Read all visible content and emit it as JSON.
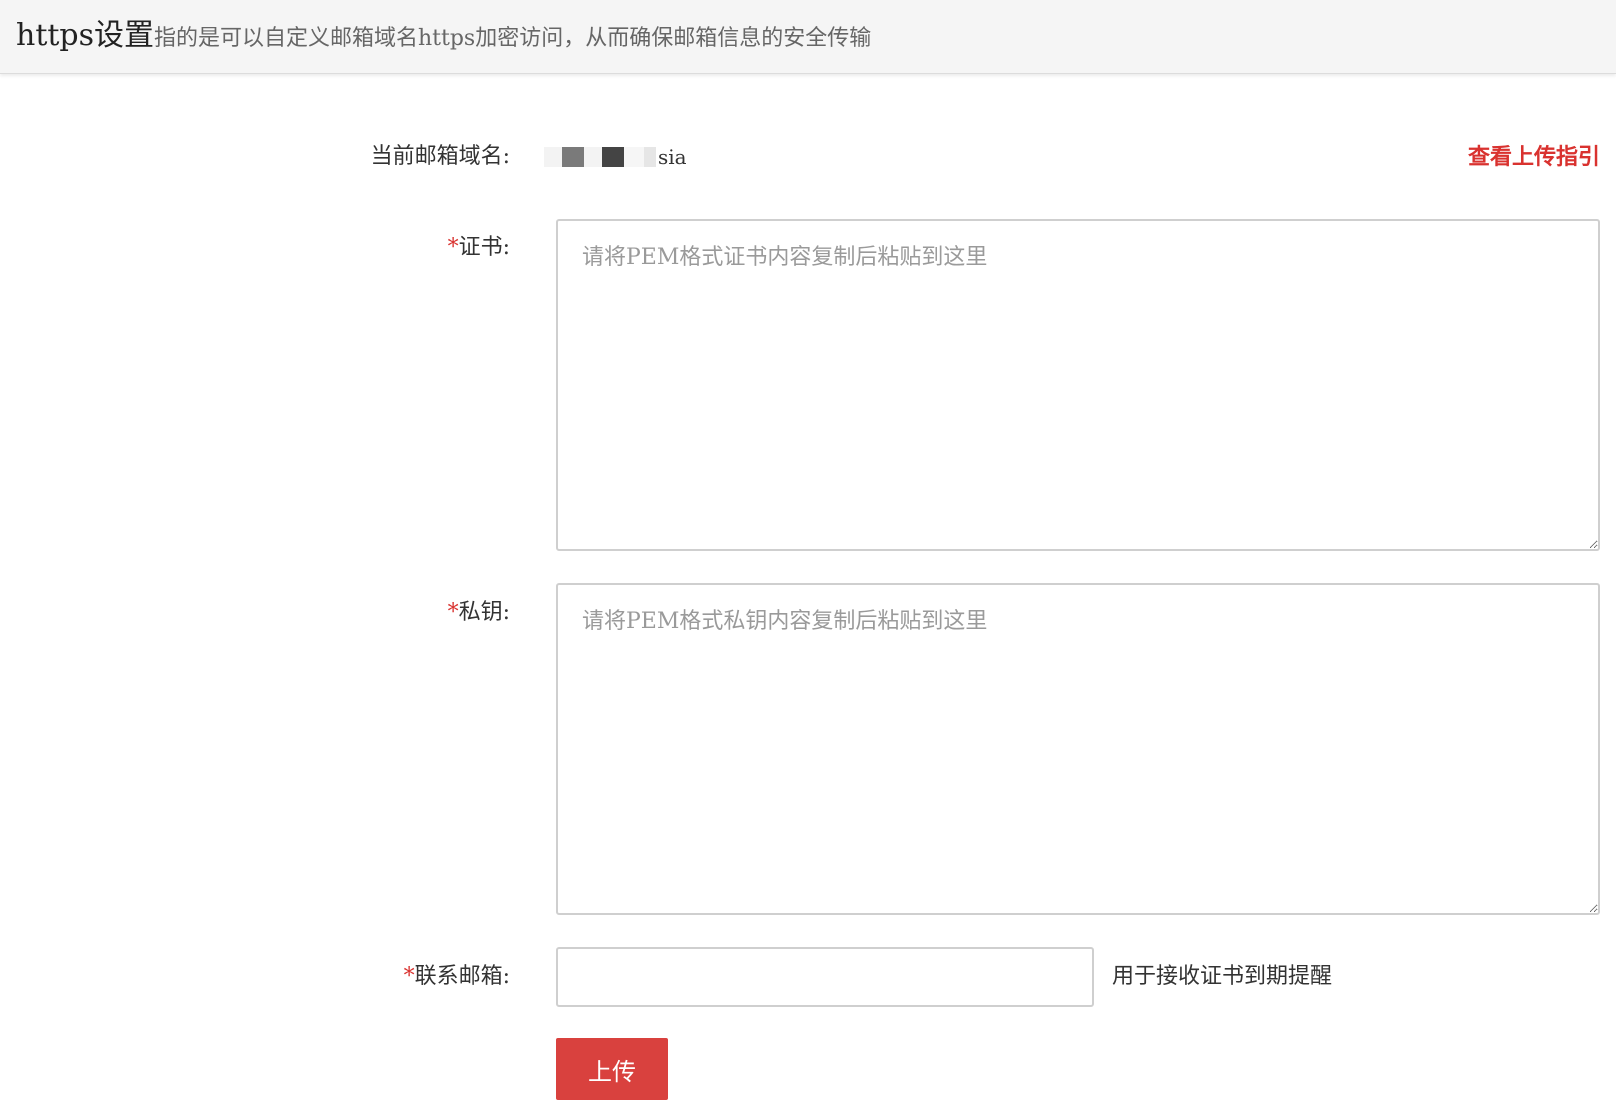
{
  "header": {
    "title": "https设置",
    "description": "指的是可以自定义邮箱域名https加密访问，从而确保邮箱信息的安全传输"
  },
  "form": {
    "domain_label": "当前邮箱域名:",
    "domain_value_visible": "sia",
    "guide_link": "查看上传指引",
    "required_mark": "*",
    "cert_label": "证书:",
    "cert_placeholder": "请将PEM格式证书内容复制后粘贴到这里",
    "key_label": "私钥:",
    "key_placeholder": "请将PEM格式私钥内容复制后粘贴到这里",
    "email_label": "联系邮箱:",
    "email_value": "",
    "email_hint": "用于接收证书到期提醒",
    "upload_button": "上传"
  },
  "colors": {
    "accent_red": "#d9413e",
    "header_bg": "#f5f5f5"
  }
}
